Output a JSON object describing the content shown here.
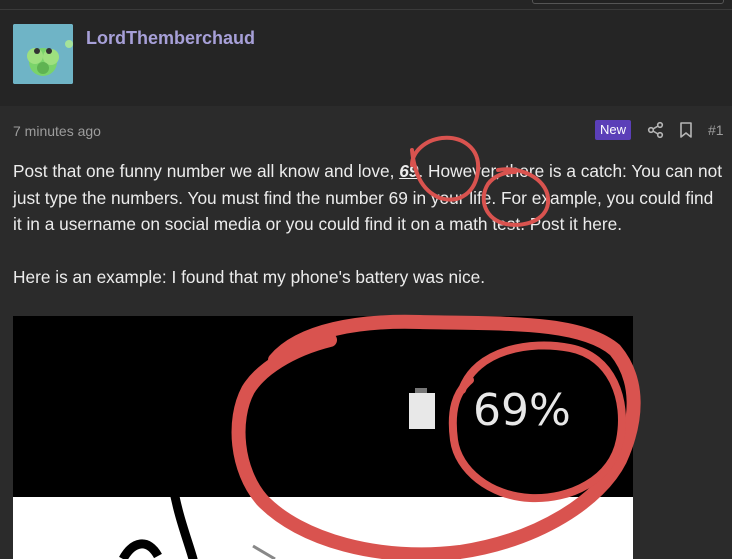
{
  "post": {
    "author": "LordThemberchaud",
    "timestamp": "7 minutes ago",
    "badge": "New",
    "number": "#1",
    "para1_a": "Post that one funny number we all know and love, ",
    "para1_num": "69",
    "para1_b": ". However, there is a catch: You can not just type the numbers. You must find the number 69 in your life. For example, you could find it in a username on social media or you could find it on a math test. Post it here.",
    "para2": "Here is an example: I found that my phone's battery was nice.",
    "image": {
      "battery_text": "69%"
    }
  },
  "icons": {
    "share": "share-icon",
    "bookmark": "bookmark-icon",
    "battery": "battery-icon"
  },
  "colors": {
    "background": "#2b2b2b",
    "header": "#252525",
    "username": "#a7a0d8",
    "badge": "#5b3fb8",
    "annotation": "#d9534f"
  }
}
